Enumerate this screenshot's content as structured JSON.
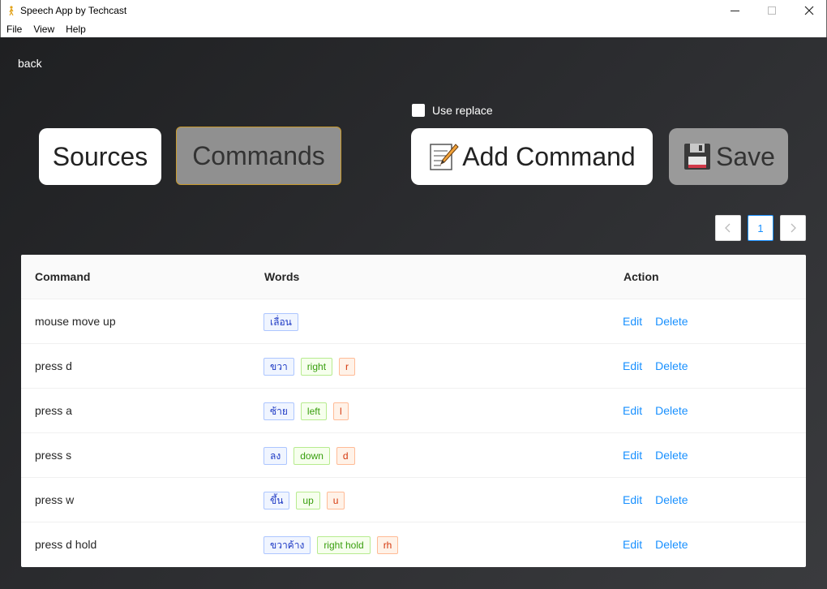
{
  "window": {
    "title": "Speech App by Techcast",
    "minimize": "─",
    "close": "✕"
  },
  "menu": [
    "File",
    "View",
    "Help"
  ],
  "nav": {
    "back": "back",
    "use_replace": "Use replace",
    "sources": "Sources",
    "commands": "Commands",
    "add_command": "Add Command",
    "save": "Save"
  },
  "pagination": {
    "prev": "‹",
    "page": "1",
    "next": "›"
  },
  "table": {
    "headers": [
      "Command",
      "Words",
      "Action"
    ],
    "rows": [
      {
        "command": "mouse move up",
        "words": [
          "เลื่อน"
        ]
      },
      {
        "command": "press d",
        "words": [
          "ขวา",
          "right",
          "r"
        ]
      },
      {
        "command": "press a",
        "words": [
          "ซ้าย",
          "left",
          "l"
        ]
      },
      {
        "command": "press s",
        "words": [
          "ลง",
          "down",
          "d"
        ]
      },
      {
        "command": "press w",
        "words": [
          "ขึ้น",
          "up",
          "u"
        ]
      },
      {
        "command": "press d hold",
        "words": [
          "ขวาค้าง",
          "right hold",
          "rh"
        ]
      }
    ],
    "edit_label": "Edit",
    "delete_label": "Delete"
  },
  "colors": {
    "accent": "#1890ff",
    "active_tab_border": "#c89a2e",
    "tag_thai": "#1d39c4",
    "tag_english": "#389e0d",
    "tag_short": "#d4380d"
  }
}
